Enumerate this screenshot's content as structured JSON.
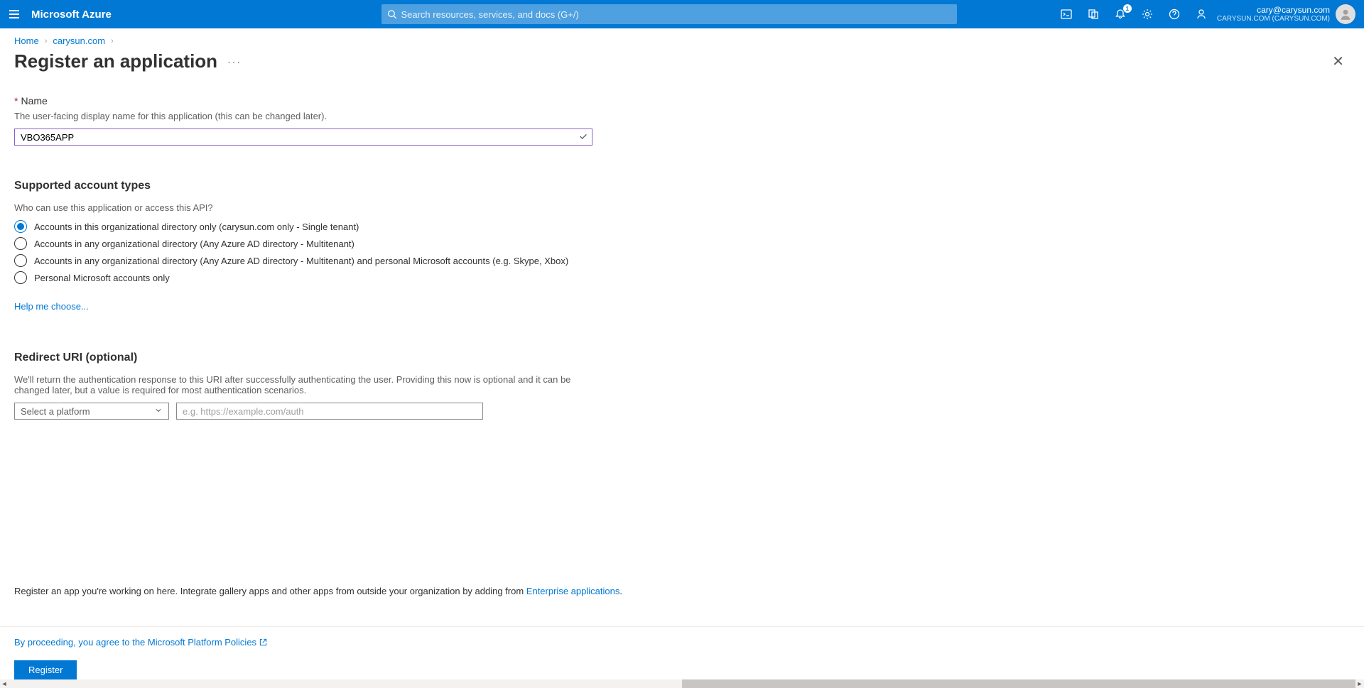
{
  "header": {
    "brand": "Microsoft Azure",
    "search_placeholder": "Search resources, services, and docs (G+/)",
    "notification_badge": "1",
    "user_email": "cary@carysun.com",
    "user_tenant": "CARYSUN.COM (CARYSUN.COM)"
  },
  "breadcrumb": {
    "home": "Home",
    "tenant": "carysun.com"
  },
  "page": {
    "title": "Register an application"
  },
  "name_section": {
    "label": "Name",
    "helper": "The user-facing display name for this application (this can be changed later).",
    "value": "VBO365APP"
  },
  "account_types": {
    "heading": "Supported account types",
    "helper": "Who can use this application or access this API?",
    "options": [
      "Accounts in this organizational directory only (carysun.com only - Single tenant)",
      "Accounts in any organizational directory (Any Azure AD directory - Multitenant)",
      "Accounts in any organizational directory (Any Azure AD directory - Multitenant) and personal Microsoft accounts (e.g. Skype, Xbox)",
      "Personal Microsoft accounts only"
    ],
    "selected_index": 0,
    "help_link": "Help me choose..."
  },
  "redirect": {
    "heading": "Redirect URI (optional)",
    "helper": "We'll return the authentication response to this URI after successfully authenticating the user. Providing this now is optional and it can be changed later, but a value is required for most authentication scenarios.",
    "platform_placeholder": "Select a platform",
    "uri_placeholder": "e.g. https://example.com/auth"
  },
  "bottom_note": {
    "prefix": "Register an app you're working on here. Integrate gallery apps and other apps from outside your organization by adding from ",
    "link": "Enterprise applications",
    "suffix": "."
  },
  "footer": {
    "policy": "By proceeding, you agree to the Microsoft Platform Policies",
    "register": "Register"
  }
}
